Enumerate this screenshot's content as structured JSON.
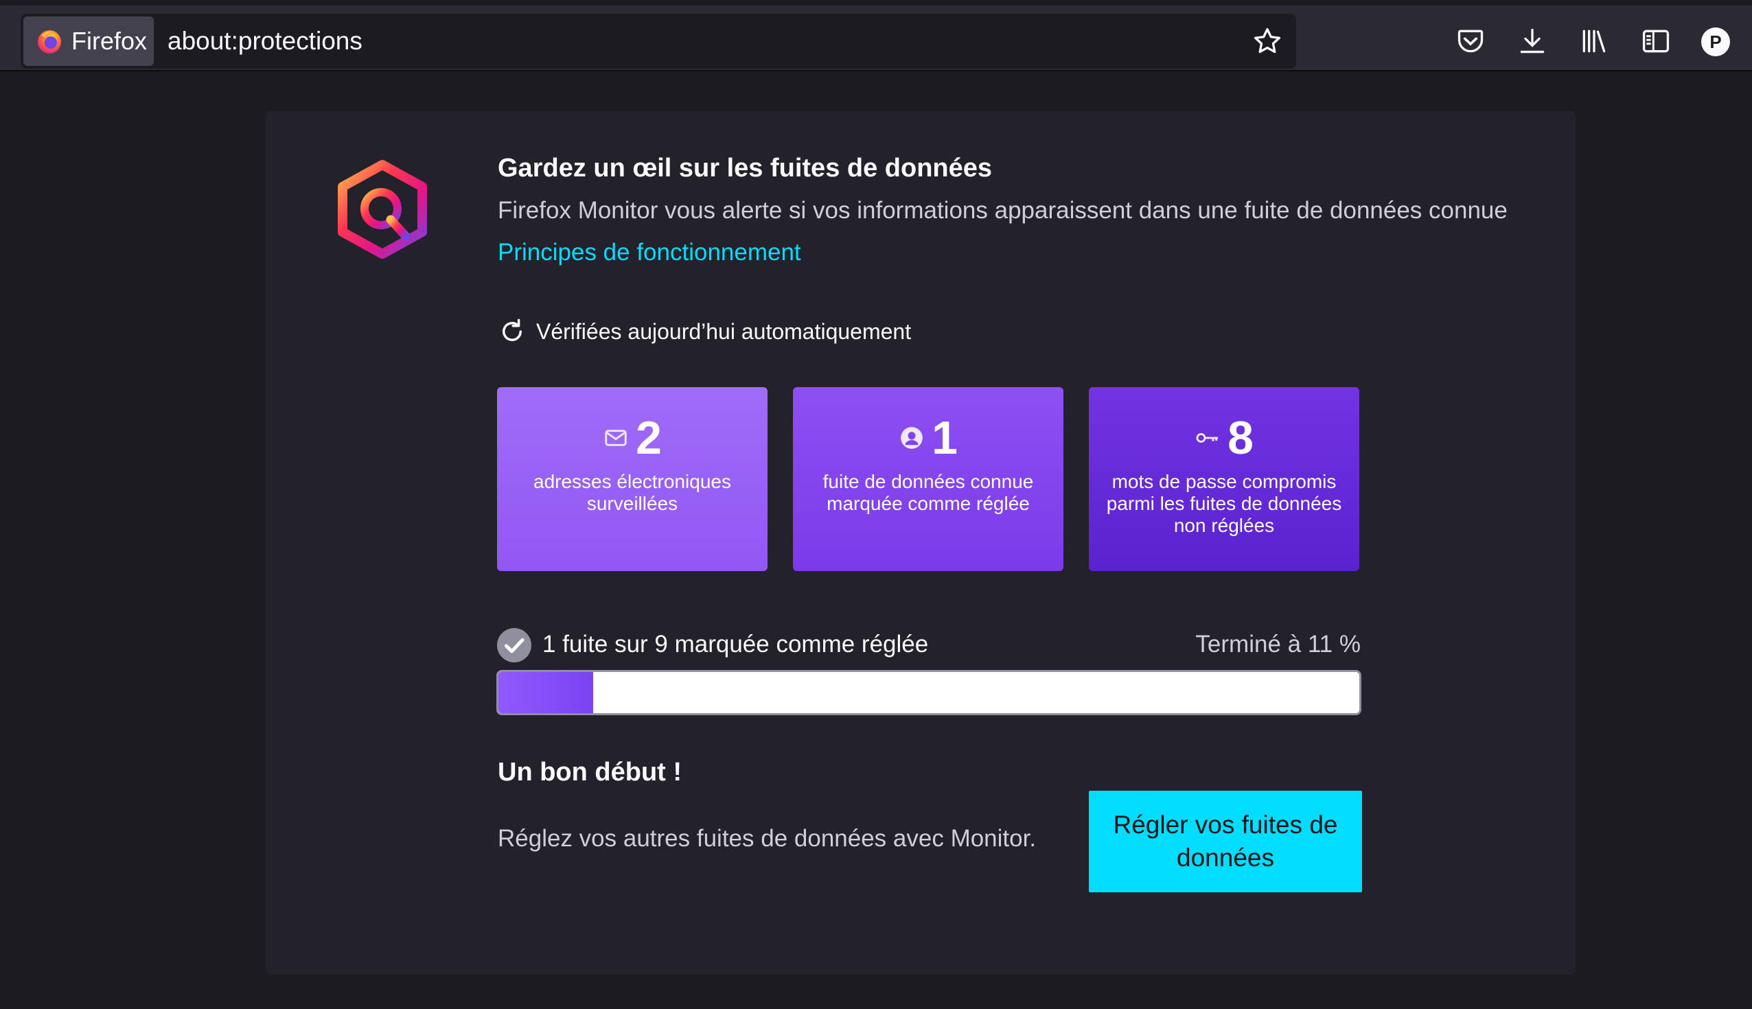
{
  "browser": {
    "identity_label": "Firefox",
    "url": "about:protections",
    "profile_initial": "P"
  },
  "monitor": {
    "heading": "Gardez un œil sur les fuites de données",
    "subtitle": "Firefox Monitor vous alerte si vos informations apparaissent dans une fuite de données connue",
    "how_link": "Principes de fonctionnement",
    "checked_status": "Vérifiées aujourd’hui automatiquement",
    "stats": [
      {
        "icon": "mail-icon",
        "value": "2",
        "label": "adresses électroniques surveillées"
      },
      {
        "icon": "user-icon",
        "value": "1",
        "label": "fuite de données connue marquée comme réglée"
      },
      {
        "icon": "key-icon",
        "value": "8",
        "label": "mots de passe compromis parmi les fuites de données non réglées"
      }
    ],
    "progress": {
      "label": "1 fuite sur 9 marquée comme réglée",
      "percent_text": "Terminé à 11 %",
      "fraction": 0.11
    },
    "good_start": "Un bon début !",
    "fix_text": "Réglez vos autres fuites de données avec Monitor.",
    "fix_button": "Régler vos fuites de données"
  },
  "colors": {
    "accent_link": "#00ddff",
    "progress_fill": "#9059ff",
    "card_bg": "#23222b"
  }
}
